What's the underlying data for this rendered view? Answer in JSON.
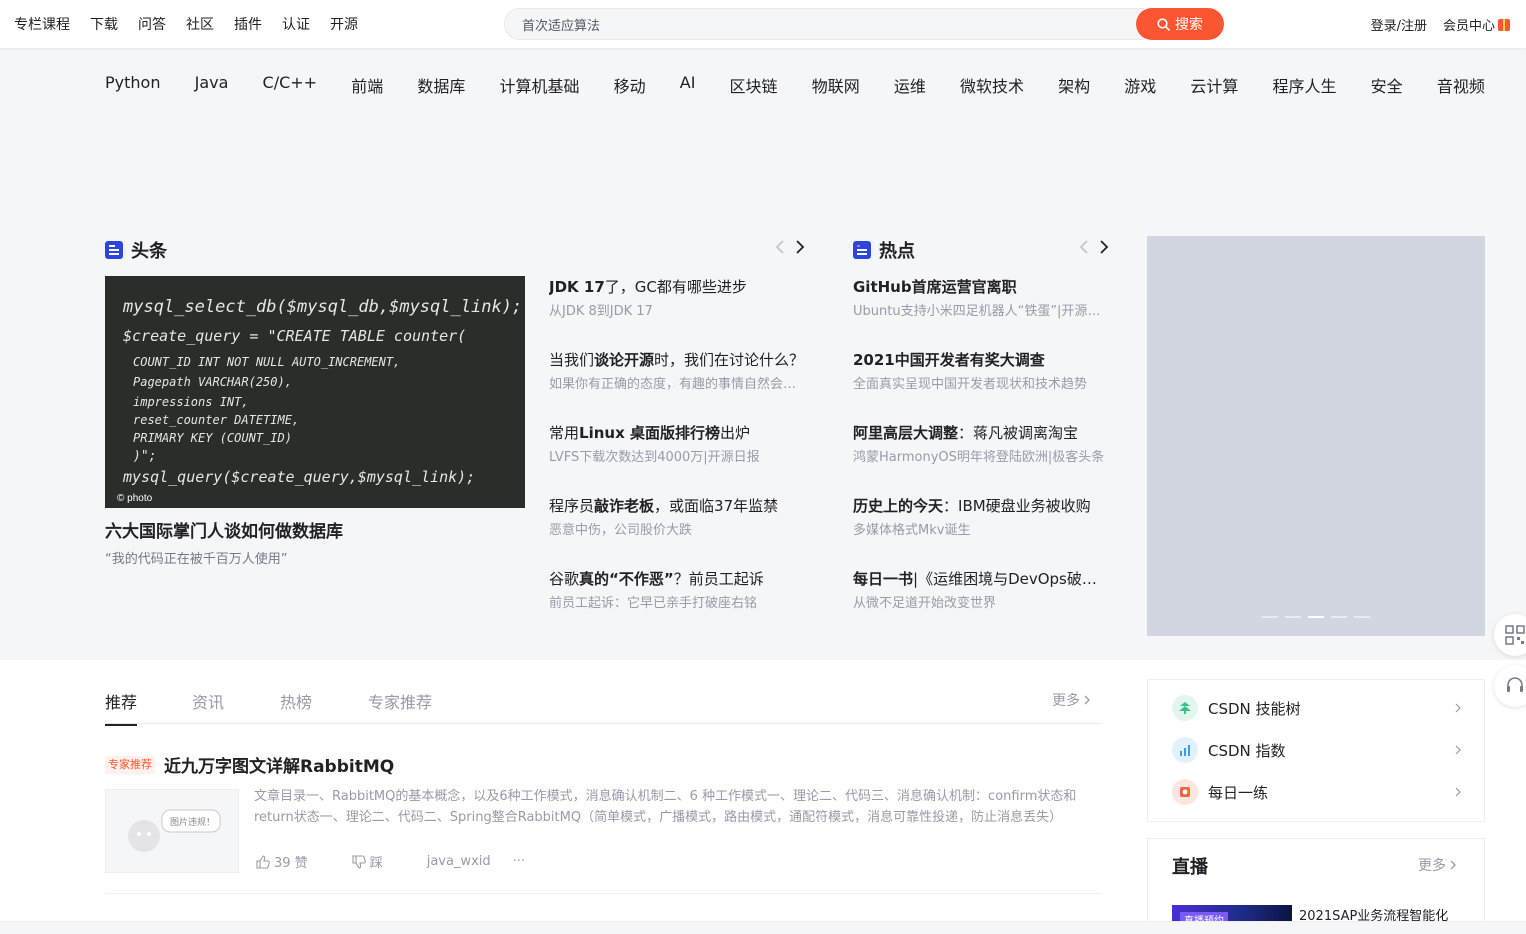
{
  "top_nav": {
    "items": [
      "专栏课程",
      "下载",
      "问答",
      "社区",
      "插件",
      "认证",
      "开源"
    ]
  },
  "search": {
    "value": "首次适应算法",
    "button_label": "搜索"
  },
  "user": {
    "login_label": "登录/注册",
    "vip_label": "会员中心"
  },
  "categories": [
    "Python",
    "Java",
    "C/C++",
    "前端",
    "数据库",
    "计算机基础",
    "移动",
    "AI",
    "区块链",
    "物联网",
    "运维",
    "微软技术",
    "架构",
    "游戏",
    "云计算",
    "程序人生",
    "安全",
    "音视频"
  ],
  "headlines": {
    "title": "头条",
    "image": {
      "lines": [
        "mysql_select_db($mysql_db,$mysql_link);",
        "$create_query = \"CREATE TABLE counter(",
        "  COUNT_ID INT NOT NULL AUTO_INCREMENT,",
        "  Pagepath VARCHAR(250),",
        "  impressions INT,",
        "  reset_counter DATETIME,",
        "  PRIMARY KEY (COUNT_ID)",
        ")\";",
        "mysql_query($create_query,$mysql_link);"
      ],
      "watermark": "photo"
    },
    "main_title": "六大国际掌门人谈如何做数据库",
    "main_sub": "“我的代码正在被千百万人使用”",
    "items": [
      {
        "pre": "",
        "bold": "JDK 17",
        "post": "了，GC都有哪些进步",
        "sub": "从JDK 8到JDK 17"
      },
      {
        "pre": "当我们",
        "bold": "谈论开源",
        "post": "时，我们在讨论什么？",
        "sub": "如果你有正确的态度，有趣的事情自然会发生"
      },
      {
        "pre": "常用",
        "bold": "Linux 桌面版排行榜",
        "post": "出炉",
        "sub": "LVFS下载次数达到4000万|开源日报"
      },
      {
        "pre": "程序员",
        "bold": "敲诈老板",
        "post": "，或面临37年监禁",
        "sub": "恶意中伤，公司股价大跌"
      },
      {
        "pre": "谷歌",
        "bold": "真的“不作恶”",
        "post": "？前员工起诉",
        "sub": "前员工起诉：它早已亲手打破座右铭"
      }
    ]
  },
  "hot": {
    "title": "热点",
    "items": [
      {
        "pre": "",
        "bold": "GitHub首席运营官离职",
        "post": "",
        "sub": "Ubuntu支持小米四足机器人“铁蛋”|开源日报"
      },
      {
        "pre": "",
        "bold": "2021中国开发者有奖大调查",
        "post": "",
        "sub": "全面真实呈现中国开发者现状和技术趋势"
      },
      {
        "pre": "",
        "bold": "阿里高层大调整",
        "post": "：蒋凡被调离淘宝",
        "sub": "鸿蒙HarmonyOS明年将登陆欧洲|极客头条"
      },
      {
        "pre": "",
        "bold": "历史上的今天",
        "post": "：IBM硬盘业务被收购",
        "sub": "多媒体格式Mkv诞生"
      },
      {
        "pre": "",
        "bold": "每日一书",
        "post": "|《运维困境与DevOps破局》",
        "sub": "从微不足道开始改变世界"
      }
    ]
  },
  "banner": {
    "slide_count": 5,
    "active_index": 2
  },
  "feed_tabs": {
    "items": [
      "推荐",
      "资讯",
      "热榜",
      "专家推荐"
    ],
    "active": "推荐",
    "more_label": "更多"
  },
  "feed": {
    "tag": "专家推荐",
    "title": "近九万字图文详解RabbitMQ",
    "desc": "文章目录一、RabbitMQ的基本概念，以及6种工作模式，消息确认机制二、6 种工作模式一、理论二、代码三、消息确认机制：confirm状态和return状态一、理论二、代码二、Spring整合RabbitMQ（简单模式，广播模式，路由模式，通配符模式，消息可靠性投递，防止消息丢失）",
    "thumb_text": "图片违规！",
    "likes": "39 赞",
    "dislike_label": "踩",
    "author": "java_wxid",
    "more": "···"
  },
  "side_links": [
    {
      "label": "CSDN 技能树",
      "icon": "skill-tree-icon",
      "color": "#3fbe8d"
    },
    {
      "label": "CSDN 指数",
      "icon": "index-chart-icon",
      "color": "#3b9df2"
    },
    {
      "label": "每日一练",
      "icon": "daily-practice-icon",
      "color": "#f0643c"
    }
  ],
  "live": {
    "title": "直播",
    "more_label": "更多",
    "thumb_badge": "直播预约",
    "item_title": "2021SAP业务流程智能化"
  },
  "colors": {
    "accent": "#fc5531",
    "headline_icon": "#2d45e0"
  }
}
